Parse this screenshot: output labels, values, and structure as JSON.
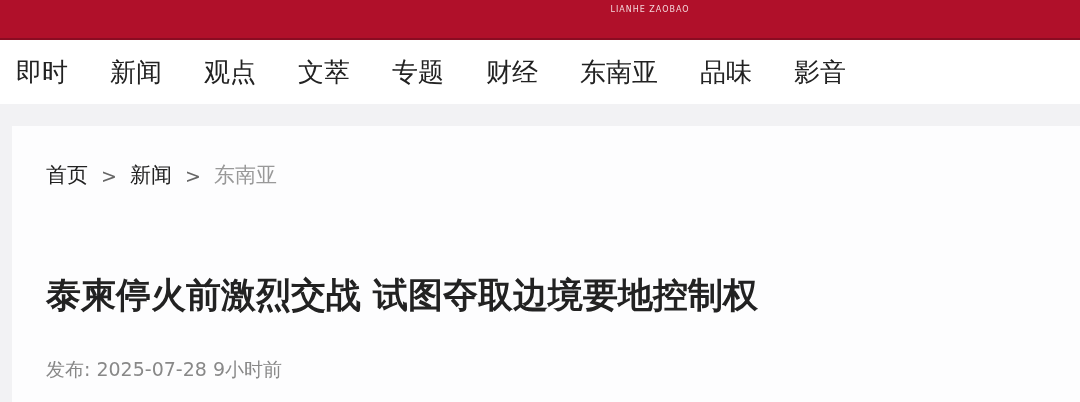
{
  "header": {
    "logo_text": "LIANHE ZAOBAO"
  },
  "nav": {
    "items": [
      "即时",
      "新闻",
      "观点",
      "文萃",
      "专题",
      "财经",
      "东南亚",
      "品味",
      "影音"
    ]
  },
  "breadcrumb": [
    {
      "kind": "link",
      "text": "首页"
    },
    {
      "kind": "separator",
      "text": ">"
    },
    {
      "kind": "link",
      "text": "新闻"
    },
    {
      "kind": "separator",
      "text": ">"
    },
    {
      "kind": "current",
      "text": "东南亚"
    }
  ],
  "article": {
    "title": "泰柬停火前激烈交战 试图夺取边境要地控制权",
    "meta": "发布: 2025-07-28 9小时前"
  }
}
